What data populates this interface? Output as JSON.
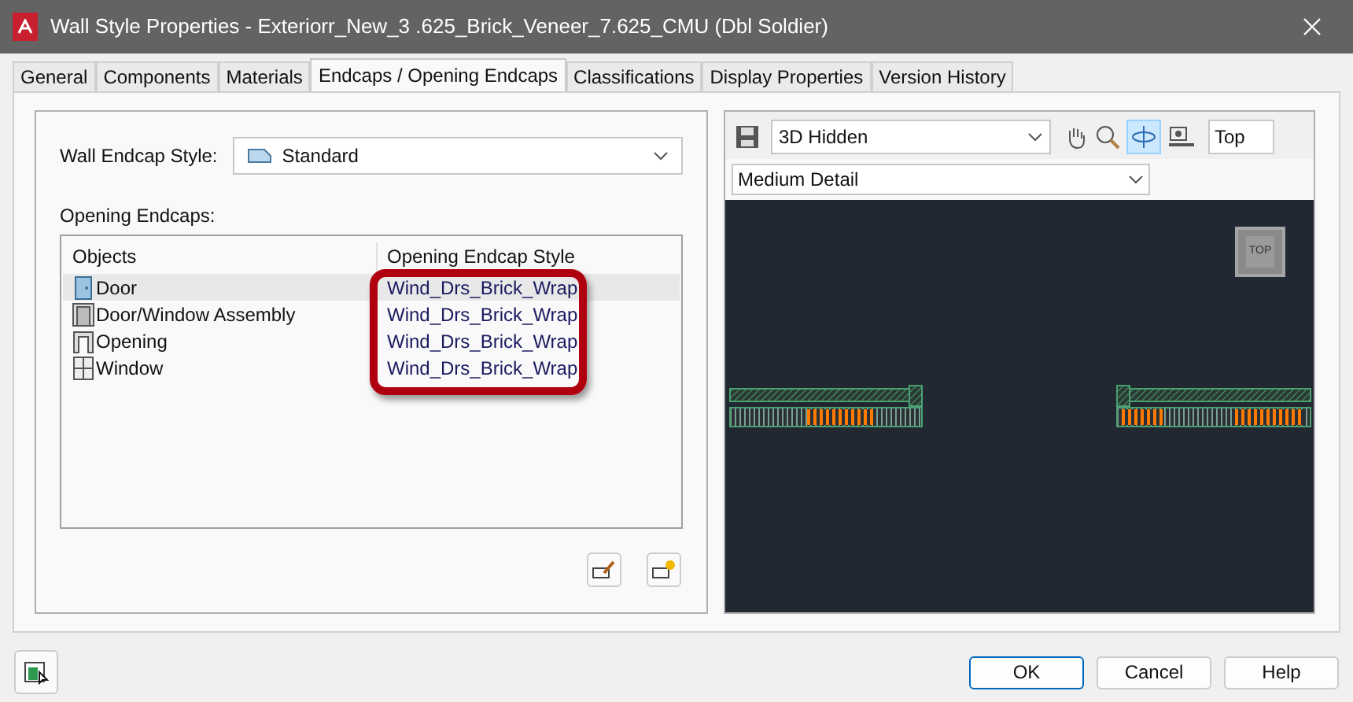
{
  "window": {
    "title": "Wall Style Properties - Exteriorr_New_3 .625_Brick_Veneer_7.625_CMU (Dbl Soldier)"
  },
  "tabs": [
    {
      "label": "General",
      "selected": false
    },
    {
      "label": "Components",
      "selected": false
    },
    {
      "label": "Materials",
      "selected": false
    },
    {
      "label": "Endcaps / Opening Endcaps",
      "selected": true
    },
    {
      "label": "Classifications",
      "selected": false
    },
    {
      "label": "Display Properties",
      "selected": false
    },
    {
      "label": "Version History",
      "selected": false
    }
  ],
  "wall_endcap_style": {
    "label": "Wall Endcap Style:",
    "value": "Standard"
  },
  "opening_endcaps": {
    "label": "Opening Endcaps:",
    "columns": [
      "Objects",
      "Opening Endcap Style"
    ],
    "rows": [
      {
        "kind": "door",
        "object": "Door",
        "style": "Wind_Drs_Brick_Wrap",
        "selected": true
      },
      {
        "kind": "assembly",
        "object": "Door/Window Assembly",
        "style": "Wind_Drs_Brick_Wrap",
        "selected": false
      },
      {
        "kind": "opening",
        "object": "Opening",
        "style": "Wind_Drs_Brick_Wrap",
        "selected": false
      },
      {
        "kind": "window",
        "object": "Window",
        "style": "Wind_Drs_Brick_Wrap",
        "selected": false
      }
    ]
  },
  "viewer": {
    "visual_style": "3D Hidden",
    "view": "Top",
    "detail": "Medium Detail",
    "viewcube": "TOP",
    "orbit_active": true
  },
  "buttons": [
    "OK",
    "Cancel",
    "Help"
  ]
}
